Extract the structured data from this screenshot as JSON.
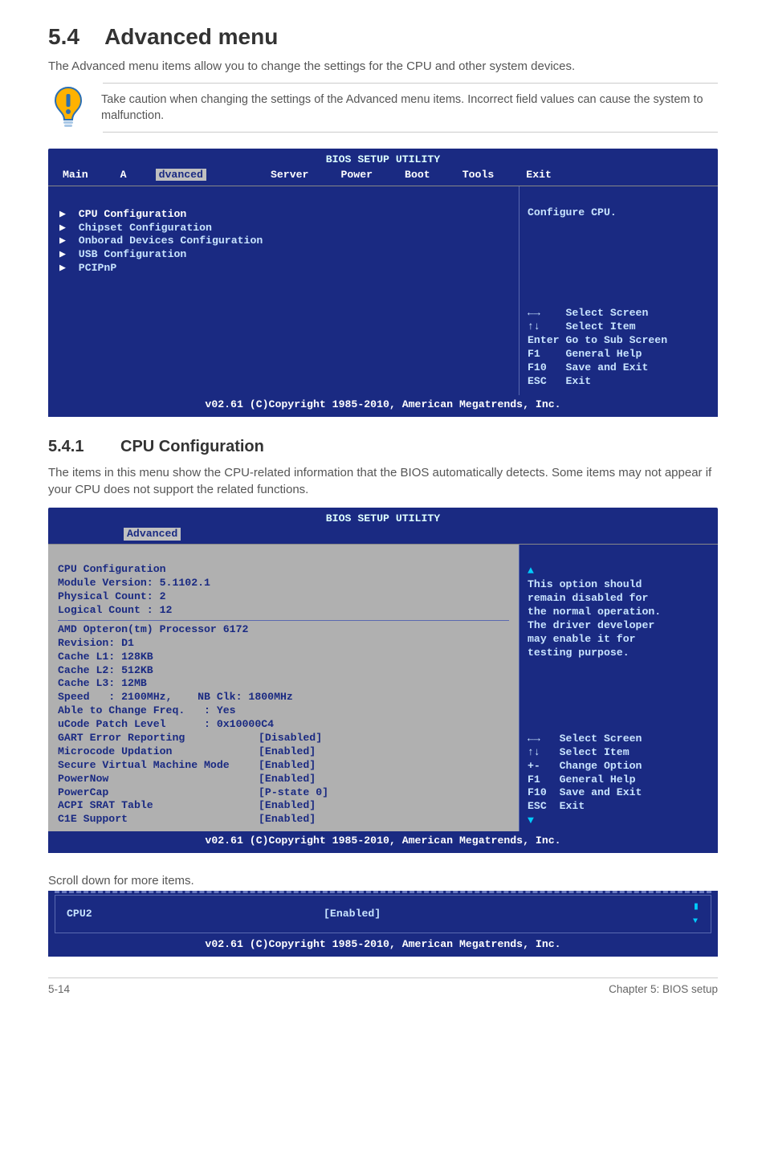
{
  "section": {
    "number": "5.4",
    "title": "Advanced menu",
    "intro": "The Advanced menu items allow you to change the settings for the CPU and other system devices."
  },
  "caution": {
    "text": "Take caution when changing the settings of the Advanced menu items. Incorrect field values can cause the system to malfunction."
  },
  "bios1": {
    "title": "BIOS SETUP UTILITY",
    "menus": {
      "main": "Main",
      "advanced_prefix": "A",
      "advanced_sel": "dvanced",
      "server": "Server",
      "power": "Power",
      "boot": "Boot",
      "tools": "Tools",
      "exit": "Exit"
    },
    "items": [
      "CPU Configuration",
      "Chipset Configuration",
      "Onborad Devices Configuration",
      "USB Configuration",
      "PCIPnP"
    ],
    "help_top": "Configure CPU.",
    "nav": [
      {
        "key": "←→",
        "label": "Select Screen"
      },
      {
        "key": "↑↓",
        "label": "Select Item"
      },
      {
        "key": "Enter",
        "label": "Go to Sub Screen"
      },
      {
        "key": "F1",
        "label": "General Help"
      },
      {
        "key": "F10",
        "label": "Save and Exit"
      },
      {
        "key": "ESC",
        "label": "Exit"
      }
    ],
    "footer": "v02.61 (C)Copyright 1985-2010, American Megatrends, Inc."
  },
  "sub": {
    "number": "5.4.1",
    "title": "CPU Configuration",
    "intro": "The items in this menu show the CPU-related information that the BIOS automatically detects. Some items may not appear if your CPU does not support the related functions."
  },
  "bios2": {
    "title": "BIOS SETUP UTILITY",
    "tab": "Advanced",
    "header": "CPU Configuration",
    "info_lines": [
      "Module Version: 5.1102.1",
      "Physical Count: 2",
      "Logical Count : 12"
    ],
    "proc_lines": [
      "AMD Opteron(tm) Processor 6172",
      "Revision: D1",
      "Cache L1: 128KB",
      "Cache L2: 512KB",
      "Cache L3: 12MB",
      "Speed   : 2100MHz,    NB Clk: 1800MHz",
      "Able to Change Freq.   : Yes",
      "uCode Patch Level      : 0x10000C4"
    ],
    "settings": [
      {
        "name": "GART Error Reporting",
        "val": "[Disabled]"
      },
      {
        "name": "Microcode Updation",
        "val": "[Enabled]"
      },
      {
        "name": "Secure Virtual Machine Mode",
        "val": "[Enabled]"
      },
      {
        "name": "PowerNow",
        "val": "[Enabled]"
      },
      {
        "name": "PowerCap",
        "val": "[P-state 0]"
      },
      {
        "name": "ACPI SRAT Table",
        "val": "[Enabled]"
      },
      {
        "name": "C1E Support",
        "val": "[Enabled]"
      }
    ],
    "help_lines": [
      "This option should",
      "remain disabled for",
      "the normal operation.",
      "The driver developer",
      "may enable it for",
      "testing purpose."
    ],
    "nav": [
      {
        "key": "←→",
        "label": "Select Screen"
      },
      {
        "key": "↑↓",
        "label": "Select Item"
      },
      {
        "key": "+-",
        "label": "Change Option"
      },
      {
        "key": "F1",
        "label": "General Help"
      },
      {
        "key": "F10",
        "label": "Save and Exit"
      },
      {
        "key": "ESC",
        "label": "Exit"
      }
    ],
    "footer": "v02.61 (C)Copyright 1985-2010, American Megatrends, Inc."
  },
  "scroll_note": "Scroll down for more items.",
  "bios3": {
    "item": "CPU2",
    "val": "[Enabled]",
    "footer": "v02.61 (C)Copyright 1985-2010, American Megatrends, Inc."
  },
  "footer": {
    "left": "5-14",
    "right": "Chapter 5: BIOS setup"
  }
}
